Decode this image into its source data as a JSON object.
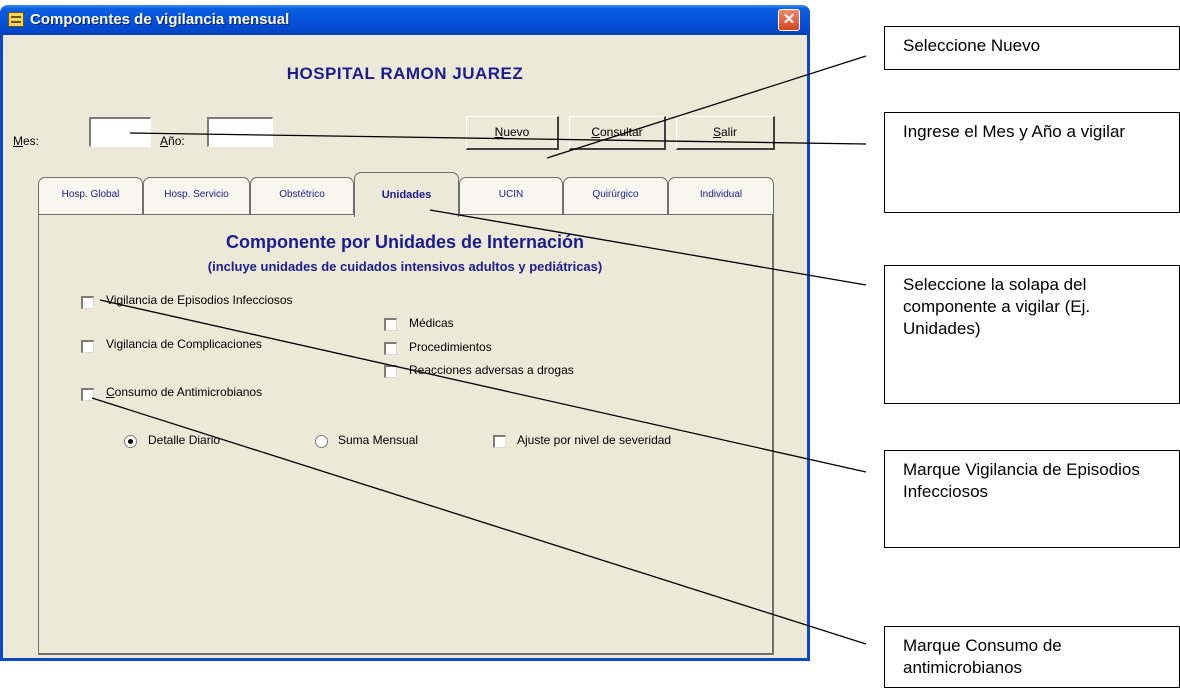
{
  "window": {
    "title": "Componentes de vigilancia mensual",
    "close_glyph": "✕",
    "hospital_name": "HOSPITAL RAMON JUAREZ"
  },
  "fields": {
    "mes_prefix": "M",
    "mes_rest": "es:",
    "anio_prefix": "A",
    "anio_rest": "ño:",
    "mes_value": "",
    "anio_value": ""
  },
  "buttons": {
    "nuevo_prefix": "N",
    "nuevo_rest": "uevo",
    "consultar_prefix": "C",
    "consultar_rest": "onsultar",
    "salir_prefix": "S",
    "salir_rest": "alir"
  },
  "tabs": [
    {
      "label": "Hosp. Global"
    },
    {
      "label": "Hosp. Servicio"
    },
    {
      "label": "Obstétrico"
    },
    {
      "label": "Unidades"
    },
    {
      "label": "UCIN"
    },
    {
      "label": "Quirúrgico"
    },
    {
      "label": "Individual"
    }
  ],
  "panel": {
    "title": "Componente por Unidades de Internación",
    "subtitle": "(incluye unidades de cuidados intensivos adultos y pediátricas)",
    "opt_episodios": "Vigilancia de Episodios Infecciosos",
    "opt_complicaciones": "Vigilancia de Complicaciones",
    "opt_medicas": "Médicas",
    "opt_procedimientos": "Procedimientos",
    "opt_reacciones": "Reacciones adversas a drogas",
    "opt_consumo_prefix": "C",
    "opt_consumo_rest": "onsumo de Antimicrobianos",
    "radio_diario": "Detalle Diario",
    "radio_mensual": "Suma Mensual",
    "opt_ajuste": "Ajuste por nivel de severidad"
  },
  "callouts": {
    "c1": "Seleccione Nuevo",
    "c2": "Ingrese el Mes y Año a vigilar",
    "c3": "Seleccione la solapa del componente a vigilar (Ej. Unidades)",
    "c4": "Marque Vigilancia de Episodios Infecciosos",
    "c5": "Marque Consumo de antimicrobianos"
  },
  "colors": {
    "titlebar": "#0654de",
    "window_bg": "#ece9d8",
    "heading_text": "#1c1c8c",
    "close_button": "#d64520"
  }
}
